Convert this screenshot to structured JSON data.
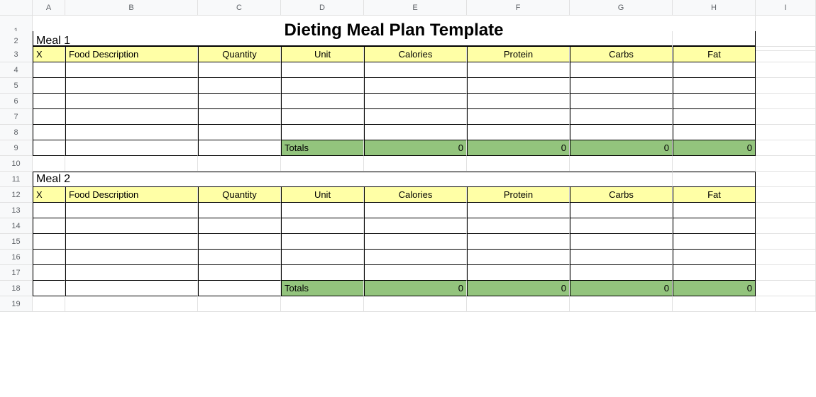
{
  "columns": [
    "A",
    "B",
    "C",
    "D",
    "E",
    "F",
    "G",
    "H",
    "I"
  ],
  "rows": [
    "1",
    "2",
    "3",
    "4",
    "5",
    "6",
    "7",
    "8",
    "9",
    "10",
    "11",
    "12",
    "13",
    "14",
    "15",
    "16",
    "17",
    "18",
    "19"
  ],
  "title": "Dieting Meal Plan Template",
  "headers": {
    "x": "X",
    "food": "Food Description",
    "qty": "Quantity",
    "unit": "Unit",
    "cal": "Calories",
    "protein": "Protein",
    "carbs": "Carbs",
    "fat": "Fat"
  },
  "totals_label": "Totals",
  "meal1": {
    "label": "Meal 1",
    "totals": {
      "cal": "0",
      "protein": "0",
      "carbs": "0",
      "fat": "0"
    }
  },
  "meal2": {
    "label": "Meal 2",
    "totals": {
      "cal": "0",
      "protein": "0",
      "carbs": "0",
      "fat": "0"
    }
  }
}
